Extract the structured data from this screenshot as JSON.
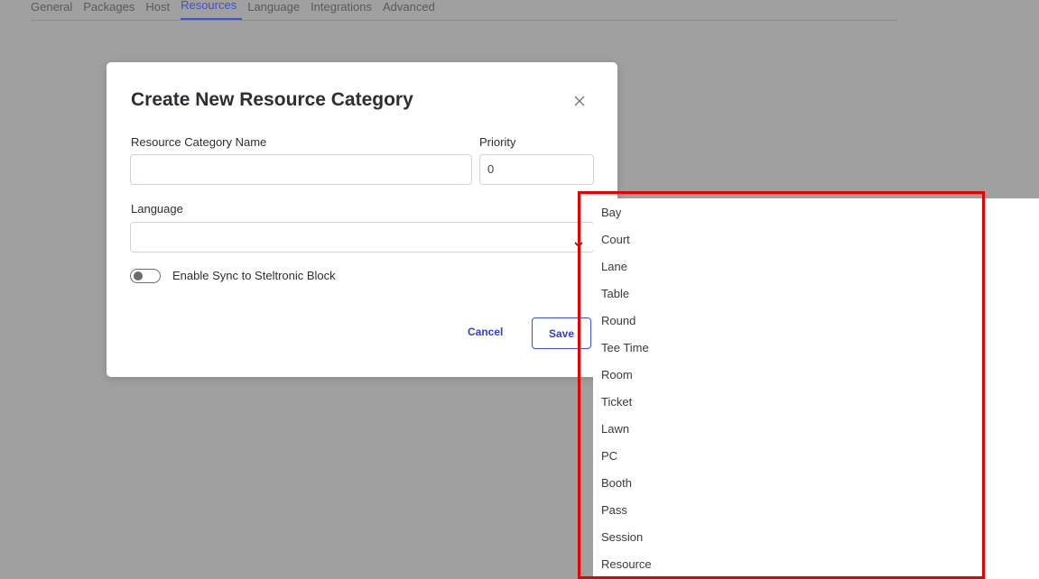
{
  "tabs": [
    {
      "label": "General",
      "active": false
    },
    {
      "label": "Packages",
      "active": false
    },
    {
      "label": "Host",
      "active": false
    },
    {
      "label": "Resources",
      "active": true
    },
    {
      "label": "Language",
      "active": false
    },
    {
      "label": "Integrations",
      "active": false
    },
    {
      "label": "Advanced",
      "active": false
    }
  ],
  "modal": {
    "title": "Create New Resource Category",
    "close_icon": "close-icon",
    "name_label": "Resource Category Name",
    "name_value": "",
    "priority_label": "Priority",
    "priority_value": "0",
    "language_label": "Language",
    "language_value": "",
    "language_icon": "chevron-down-icon",
    "toggle_label": "Enable Sync to Steltronic Block",
    "toggle_on": false,
    "cancel_label": "Cancel",
    "save_label": "Save"
  },
  "dropdown": {
    "items": [
      "Bay",
      "Court",
      "Lane",
      "Table",
      "Round",
      "Tee Time",
      "Room",
      "Ticket",
      "Lawn",
      "PC",
      "Booth",
      "Pass",
      "Session",
      "Resource"
    ]
  },
  "colors": {
    "accent": "#3e4fd8",
    "overlay": "#a0a0a0",
    "highlight_border": "#e80000"
  }
}
